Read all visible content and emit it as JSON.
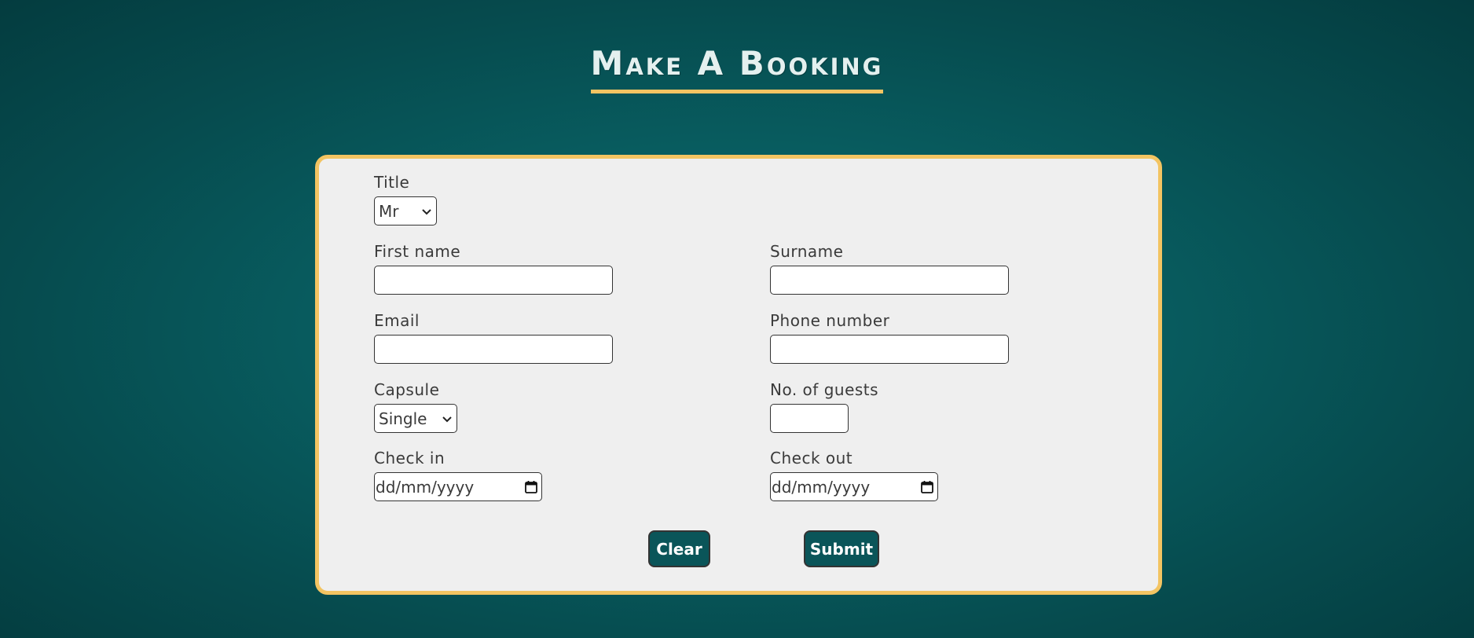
{
  "header": {
    "title": "Make A Booking"
  },
  "form": {
    "title_field": {
      "label": "Title",
      "selected": "Mr"
    },
    "first_name": {
      "label": "First name",
      "value": ""
    },
    "surname": {
      "label": "Surname",
      "value": ""
    },
    "email": {
      "label": "Email",
      "value": ""
    },
    "phone": {
      "label": "Phone number",
      "value": ""
    },
    "capsule": {
      "label": "Capsule",
      "selected": "Single"
    },
    "guests": {
      "label": "No. of guests",
      "value": ""
    },
    "check_in": {
      "label": "Check in",
      "placeholder": "dd/mm/yyyy"
    },
    "check_out": {
      "label": "Check out",
      "placeholder": "dd/mm/yyyy"
    },
    "clear_label": "Clear",
    "submit_label": "Submit"
  },
  "colors": {
    "background": "#075659",
    "accent": "#f3c462",
    "card": "#efefef",
    "button": "#0a5559"
  },
  "icons": {
    "select": "chevron-down-icon",
    "date": "calendar-icon"
  }
}
